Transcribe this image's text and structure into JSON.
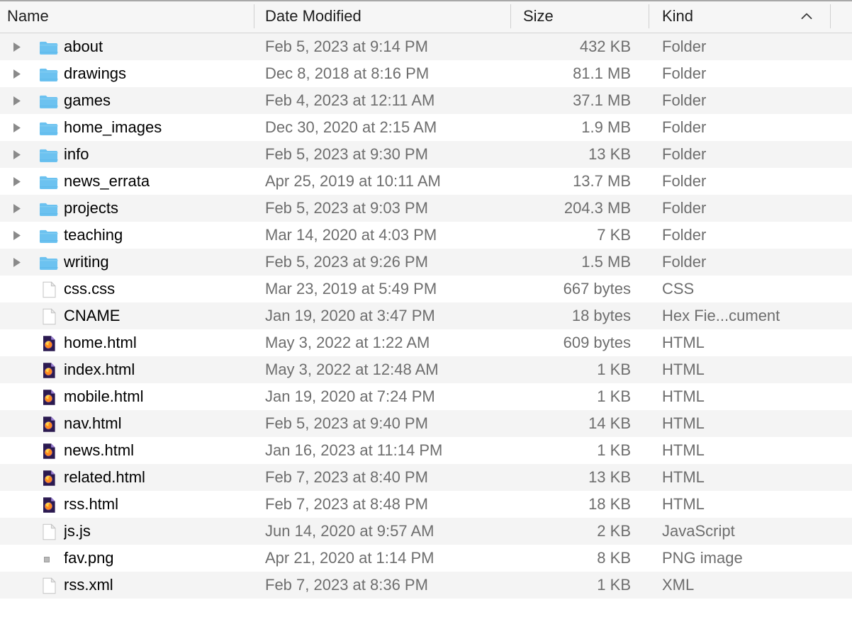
{
  "window": {
    "view": "list",
    "sort_column": "Kind",
    "sort_direction": "ascending"
  },
  "columns": {
    "name": "Name",
    "date_modified": "Date Modified",
    "size": "Size",
    "kind": "Kind",
    "sort_icon": "chevron-up-icon"
  },
  "colors": {
    "folder_blue": "#6fc3f2",
    "row_alt": "#f4f4f4",
    "row_base": "#ffffff",
    "header_bg": "#f6f6f6",
    "text_primary": "#000000",
    "text_secondary": "#6e6e6e",
    "firefox_bg": "#2b1a50",
    "firefox_orange": "#ff9500"
  },
  "rows": [
    {
      "name": "about",
      "date": "Feb 5, 2023 at 9:14 PM",
      "size": "432 KB",
      "kind": "Folder",
      "icon": "folder-icon",
      "expandable": true
    },
    {
      "name": "drawings",
      "date": "Dec 8, 2018 at 8:16 PM",
      "size": "81.1 MB",
      "kind": "Folder",
      "icon": "folder-icon",
      "expandable": true
    },
    {
      "name": "games",
      "date": "Feb 4, 2023 at 12:11 AM",
      "size": "37.1 MB",
      "kind": "Folder",
      "icon": "folder-icon",
      "expandable": true
    },
    {
      "name": "home_images",
      "date": "Dec 30, 2020 at 2:15 AM",
      "size": "1.9 MB",
      "kind": "Folder",
      "icon": "folder-icon",
      "expandable": true
    },
    {
      "name": "info",
      "date": "Feb 5, 2023 at 9:30 PM",
      "size": "13 KB",
      "kind": "Folder",
      "icon": "folder-icon",
      "expandable": true
    },
    {
      "name": "news_errata",
      "date": "Apr 25, 2019 at 10:11 AM",
      "size": "13.7 MB",
      "kind": "Folder",
      "icon": "folder-icon",
      "expandable": true
    },
    {
      "name": "projects",
      "date": "Feb 5, 2023 at 9:03 PM",
      "size": "204.3 MB",
      "kind": "Folder",
      "icon": "folder-icon",
      "expandable": true
    },
    {
      "name": "teaching",
      "date": "Mar 14, 2020 at 4:03 PM",
      "size": "7 KB",
      "kind": "Folder",
      "icon": "folder-icon",
      "expandable": true
    },
    {
      "name": "writing",
      "date": "Feb 5, 2023 at 9:26 PM",
      "size": "1.5 MB",
      "kind": "Folder",
      "icon": "folder-icon",
      "expandable": true
    },
    {
      "name": "css.css",
      "date": "Mar 23, 2019 at 5:49 PM",
      "size": "667 bytes",
      "kind": "CSS",
      "icon": "document-icon",
      "expandable": false
    },
    {
      "name": "CNAME",
      "date": "Jan 19, 2020 at 3:47 PM",
      "size": "18 bytes",
      "kind": "Hex Fie...cument",
      "icon": "document-icon",
      "expandable": false
    },
    {
      "name": "home.html",
      "date": "May 3, 2022 at 1:22 AM",
      "size": "609 bytes",
      "kind": "HTML",
      "icon": "firefox-html-icon",
      "expandable": false
    },
    {
      "name": "index.html",
      "date": "May 3, 2022 at 12:48 AM",
      "size": "1 KB",
      "kind": "HTML",
      "icon": "firefox-html-icon",
      "expandable": false
    },
    {
      "name": "mobile.html",
      "date": "Jan 19, 2020 at 7:24 PM",
      "size": "1 KB",
      "kind": "HTML",
      "icon": "firefox-html-icon",
      "expandable": false
    },
    {
      "name": "nav.html",
      "date": "Feb 5, 2023 at 9:40 PM",
      "size": "14 KB",
      "kind": "HTML",
      "icon": "firefox-html-icon",
      "expandable": false
    },
    {
      "name": "news.html",
      "date": "Jan 16, 2023 at 11:14 PM",
      "size": "1 KB",
      "kind": "HTML",
      "icon": "firefox-html-icon",
      "expandable": false
    },
    {
      "name": "related.html",
      "date": "Feb 7, 2023 at 8:40 PM",
      "size": "13 KB",
      "kind": "HTML",
      "icon": "firefox-html-icon",
      "expandable": false
    },
    {
      "name": "rss.html",
      "date": "Feb 7, 2023 at 8:48 PM",
      "size": "18 KB",
      "kind": "HTML",
      "icon": "firefox-html-icon",
      "expandable": false
    },
    {
      "name": "js.js",
      "date": "Jun 14, 2020 at 9:57 AM",
      "size": "2 KB",
      "kind": "JavaScript",
      "icon": "document-icon",
      "expandable": false
    },
    {
      "name": "fav.png",
      "date": "Apr 21, 2020 at 1:14 PM",
      "size": "8 KB",
      "kind": "PNG image",
      "icon": "image-thumbnail-icon",
      "expandable": false
    },
    {
      "name": "rss.xml",
      "date": "Feb 7, 2023 at 8:36 PM",
      "size": "1 KB",
      "kind": "XML",
      "icon": "document-icon",
      "expandable": false
    }
  ]
}
